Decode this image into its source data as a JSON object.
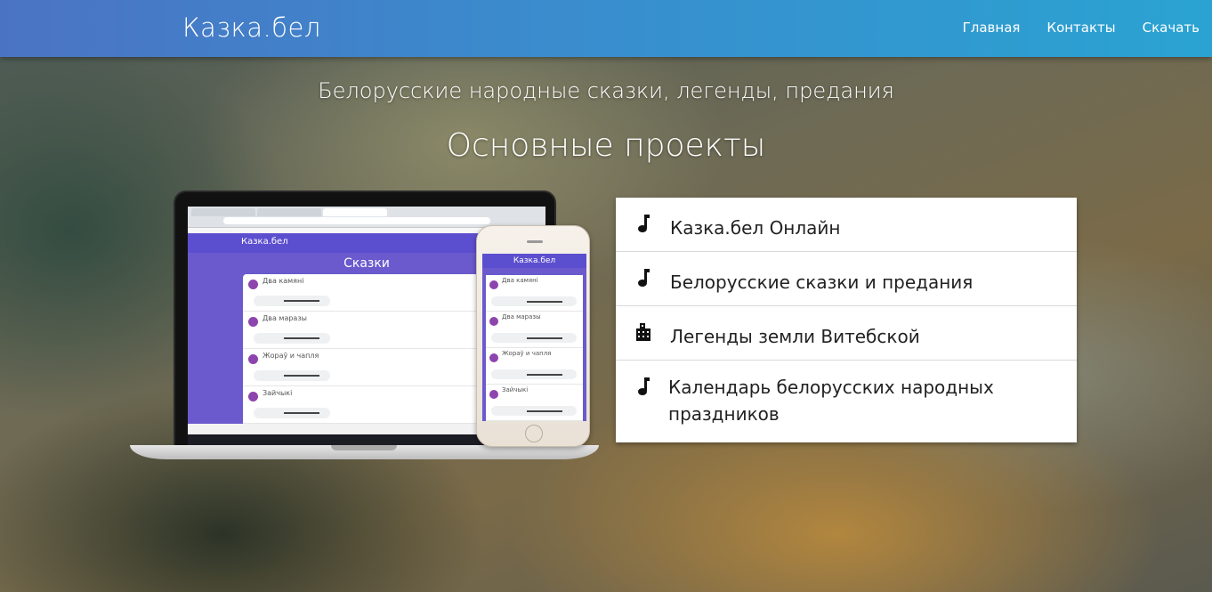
{
  "navbar": {
    "brand": "Казка.бел",
    "links": [
      "Главная",
      "Контакты",
      "Скачать"
    ]
  },
  "hero": {
    "subtitle": "Белорусские народные сказки, легенды, предания",
    "section_title": "Основные проекты"
  },
  "mockup": {
    "site_brand": "Казка.бел",
    "page_title": "Сказки",
    "tracks": [
      "Два камяні",
      "Два маразы",
      "Жораў и чапля",
      "Зайчыкі"
    ]
  },
  "projects": [
    {
      "icon": "music-note-icon",
      "label": "Казка.бел Онлайн"
    },
    {
      "icon": "music-note-icon",
      "label": "Белорусские сказки и предания"
    },
    {
      "icon": "city-icon",
      "label": "Легенды земли Витебской"
    },
    {
      "icon": "music-note-icon",
      "label": "Календарь белорусских народных праздников"
    }
  ],
  "colors": {
    "nav_start": "#4b73c4",
    "nav_end": "#2aa3d2",
    "mockup_accent": "#6a5acd"
  }
}
